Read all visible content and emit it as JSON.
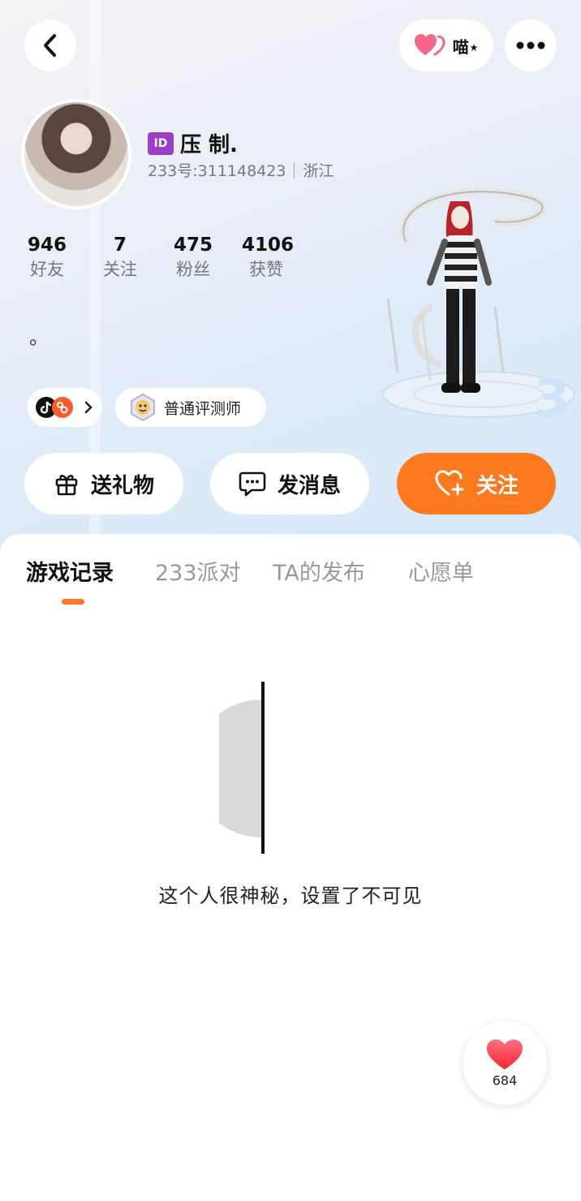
{
  "header": {
    "meow_label": "喵⋆"
  },
  "profile": {
    "id_badge": "ID",
    "username": "压 制.",
    "account_label": "233号:311148423",
    "region": "浙江",
    "bio": "。",
    "badge_label": "普通评测师"
  },
  "stats": [
    {
      "value": "946",
      "label": "好友"
    },
    {
      "value": "7",
      "label": "关注"
    },
    {
      "value": "475",
      "label": "粉丝"
    },
    {
      "value": "4106",
      "label": "获赞"
    }
  ],
  "actions": {
    "gift": "送礼物",
    "message": "发消息",
    "follow": "关注"
  },
  "tabs": [
    {
      "label": "游戏记录",
      "active": true
    },
    {
      "label": "233派对",
      "active": false
    },
    {
      "label": "TA的发布",
      "active": false
    },
    {
      "label": "心愿单",
      "active": false
    }
  ],
  "empty_state": {
    "message": "这个人很神秘，设置了不可见"
  },
  "like_fab": {
    "count": "684"
  },
  "colors": {
    "accent": "#ff7a1f",
    "id_badge": "#9b3fc9",
    "heart": "#ff3b4e"
  }
}
